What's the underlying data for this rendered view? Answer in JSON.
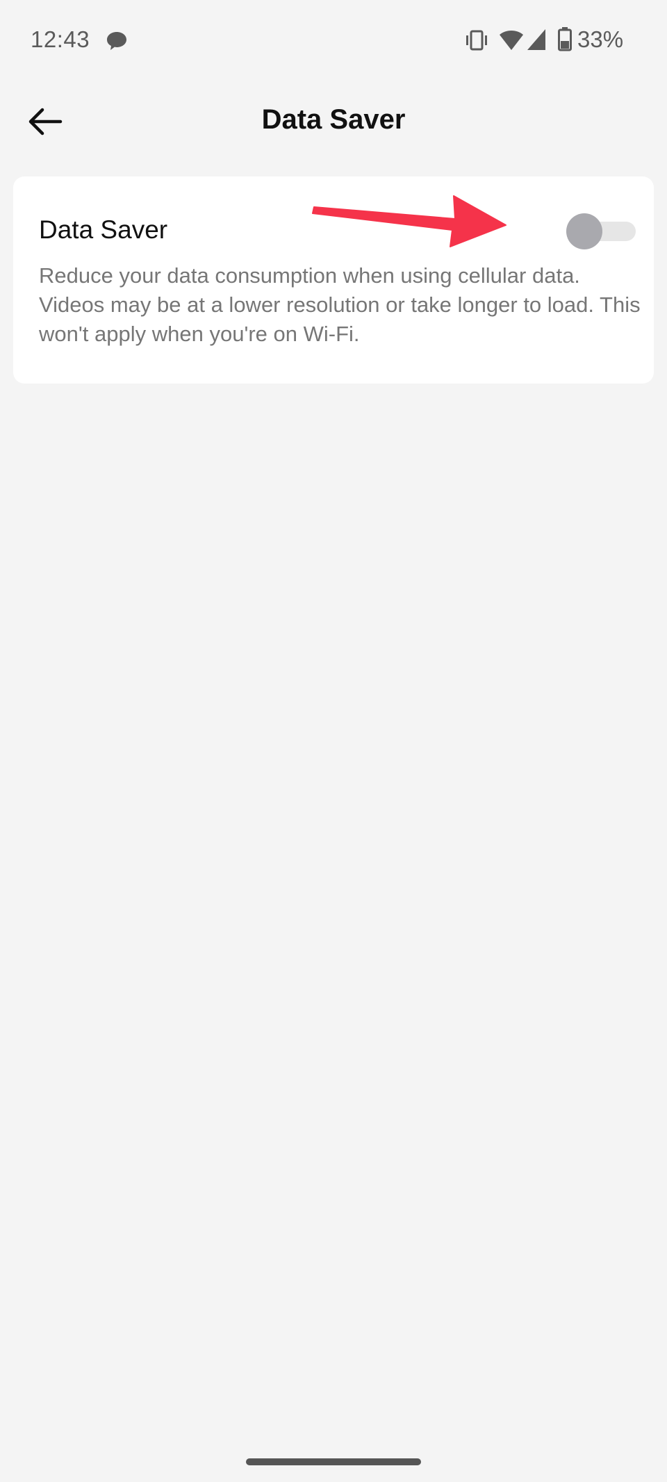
{
  "status_bar": {
    "time": "12:43",
    "battery_percent": "33%",
    "icons": [
      "chat-bubble-icon",
      "vibrate-icon",
      "wifi-icon",
      "cell-signal-icon",
      "battery-icon"
    ]
  },
  "header": {
    "back_icon": "arrow-left-icon",
    "title": "Data Saver"
  },
  "setting": {
    "title": "Data Saver",
    "description": "Reduce your data consumption when using cellular data. Videos may be at a lower resolution or take longer to load. This won't apply when you're on Wi-Fi.",
    "toggle_on": false
  },
  "colors": {
    "background": "#f4f4f4",
    "card": "#ffffff",
    "toggle_track_off": "#e6e6e6",
    "toggle_knob_off": "#a9a9ae",
    "annotation_arrow": "#f5334a"
  }
}
